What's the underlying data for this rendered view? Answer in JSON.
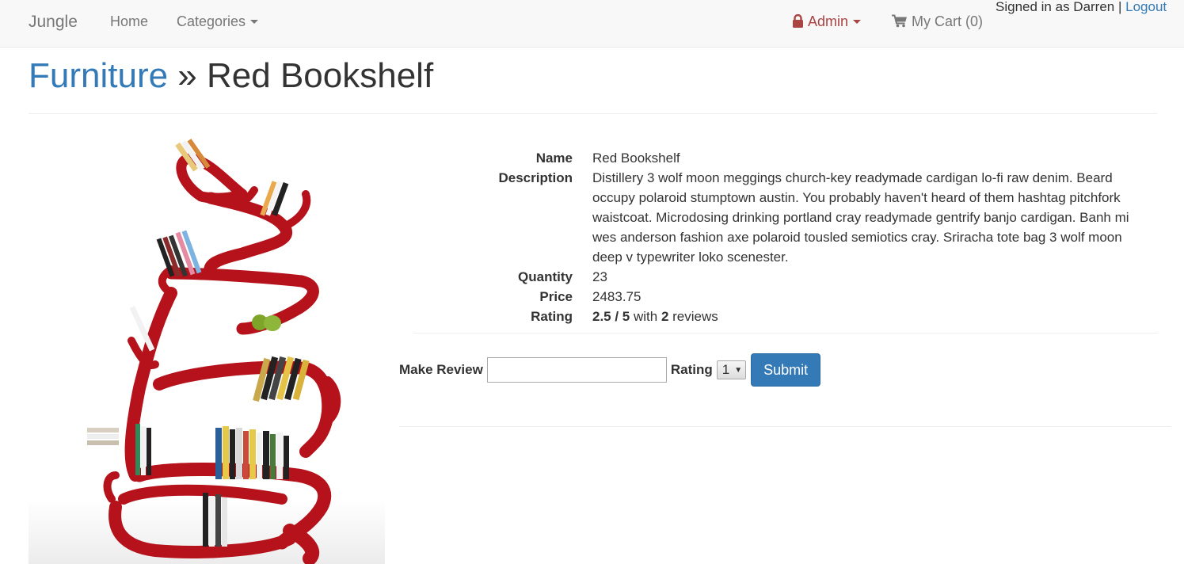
{
  "navbar": {
    "brand": "Jungle",
    "home": "Home",
    "categories": "Categories",
    "admin": "Admin",
    "cart": "My Cart (0)",
    "signed_in_text": "Signed in as Darren |",
    "logout": "Logout"
  },
  "header": {
    "category": "Furniture",
    "separator": " » ",
    "product_name": "Red Bookshelf"
  },
  "details": {
    "name_label": "Name",
    "name": "Red Bookshelf",
    "description_label": "Description",
    "description": "Distillery 3 wolf moon meggings church-key readymade cardigan lo-fi raw denim. Beard occupy polaroid stumptown austin. You probably haven't heard of them hashtag pitchfork waistcoat. Microdosing drinking portland cray readymade gentrify banjo cardigan. Banh mi wes anderson fashion axe polaroid tousled semiotics cray. Sriracha tote bag 3 wolf moon deep v typewriter loko scenester.",
    "quantity_label": "Quantity",
    "quantity": "23",
    "price_label": "Price",
    "price": "2483.75",
    "rating_label": "Rating",
    "rating_value": "2.5 / 5",
    "rating_with": " with ",
    "review_count": "2",
    "reviews_word": " reviews"
  },
  "review_form": {
    "make_review_label": "Make Review",
    "review_value": "",
    "rating_label": "Rating",
    "rating_selected": "1",
    "submit_label": "Submit"
  },
  "colors": {
    "link": "#337ab7",
    "admin": "#a94442",
    "navbar_bg": "#f8f8f8",
    "shelf_red": "#b5121b"
  },
  "icons": {
    "admin": "lock-icon",
    "cart": "shopping-cart-icon",
    "dropdown": "caret-down-icon"
  }
}
